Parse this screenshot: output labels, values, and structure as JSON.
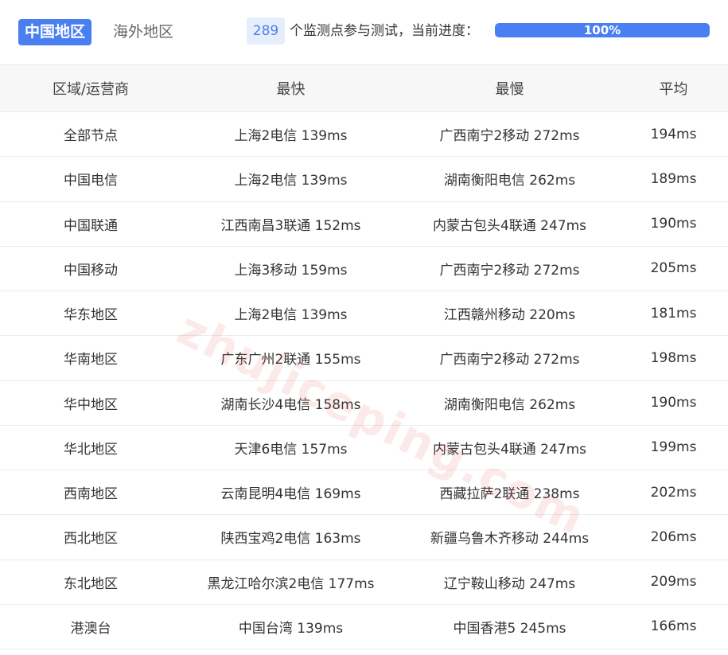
{
  "tabs": [
    {
      "label": "中国地区",
      "active": true
    },
    {
      "label": "海外地区",
      "active": false
    }
  ],
  "monitor": {
    "count": "289",
    "progress_text": "个监测点参与测试，当前进度：",
    "progress_label": "100%",
    "progress_value": 100
  },
  "watermark": "zhujiceping.com",
  "colors": {
    "accent": "#4a7ff2",
    "header_bg": "#f7f7f7"
  },
  "table": {
    "headers": [
      "区域/运营商",
      "最快",
      "最慢",
      "平均"
    ],
    "rows": [
      [
        "全部节点",
        "上海2电信 139ms",
        "广西南宁2移动 272ms",
        "194ms"
      ],
      [
        "中国电信",
        "上海2电信 139ms",
        "湖南衡阳电信 262ms",
        "189ms"
      ],
      [
        "中国联通",
        "江西南昌3联通 152ms",
        "内蒙古包头4联通 247ms",
        "190ms"
      ],
      [
        "中国移动",
        "上海3移动 159ms",
        "广西南宁2移动 272ms",
        "205ms"
      ],
      [
        "华东地区",
        "上海2电信 139ms",
        "江西赣州移动 220ms",
        "181ms"
      ],
      [
        "华南地区",
        "广东广州2联通 155ms",
        "广西南宁2移动 272ms",
        "198ms"
      ],
      [
        "华中地区",
        "湖南长沙4电信 158ms",
        "湖南衡阳电信 262ms",
        "190ms"
      ],
      [
        "华北地区",
        "天津6电信 157ms",
        "内蒙古包头4联通 247ms",
        "199ms"
      ],
      [
        "西南地区",
        "云南昆明4电信 169ms",
        "西藏拉萨2联通 238ms",
        "202ms"
      ],
      [
        "西北地区",
        "陕西宝鸡2电信 163ms",
        "新疆乌鲁木齐移动 244ms",
        "206ms"
      ],
      [
        "东北地区",
        "黑龙江哈尔滨2电信 177ms",
        "辽宁鞍山移动 247ms",
        "209ms"
      ],
      [
        "港澳台",
        "中国台湾 139ms",
        "中国香港5 245ms",
        "166ms"
      ]
    ]
  }
}
